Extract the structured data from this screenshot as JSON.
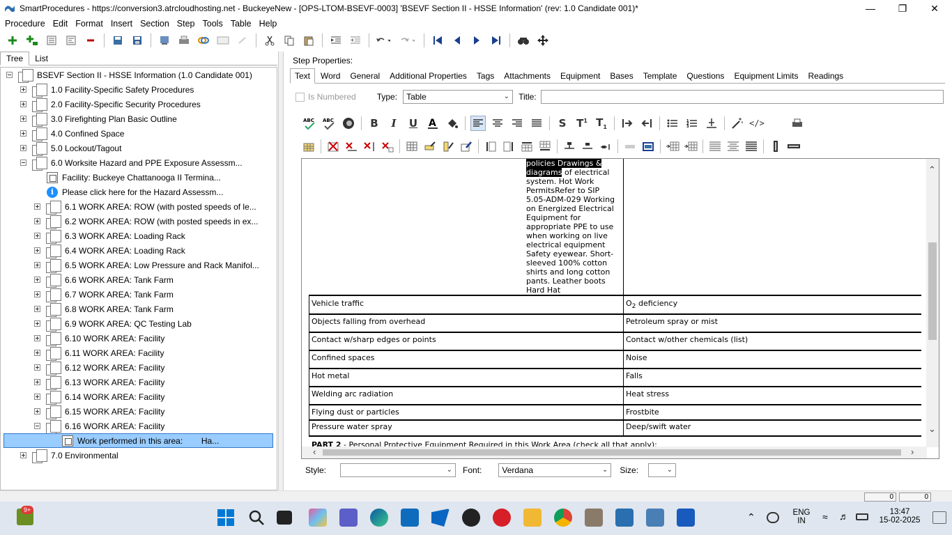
{
  "window": {
    "title": "SmartProcedures - https://conversion3.atrcloudhosting.net - BuckeyeNew - [OPS-LTOM-BSEVF-0003] 'BSEVF Section II - HSSE Information' (rev: 1.0 Candidate 001)*",
    "minimize": "—",
    "maximize": "❐",
    "close": "✕"
  },
  "menu": [
    "Procedure",
    "Edit",
    "Format",
    "Insert",
    "Section",
    "Step",
    "Tools",
    "Table",
    "Help"
  ],
  "left_tabs": [
    "Tree",
    "List"
  ],
  "tree": {
    "root": "BSEVF Section II - HSSE Information (1.0 Candidate 001)",
    "items": [
      {
        "label": "1.0 Facility-Specific Safety Procedures"
      },
      {
        "label": "2.0 Facility-Specific Security Procedures"
      },
      {
        "label": "3.0 Firefighting Plan Basic Outline"
      },
      {
        "label": "4.0 Confined Space"
      },
      {
        "label": "5.0 Lockout/Tagout"
      },
      {
        "label": "6.0 Worksite Hazard and PPE Exposure Assessm..."
      },
      {
        "label": "Facility: Buckeye Chattanooga II Termina..."
      },
      {
        "label": "Please click here for the Hazard Assessm..."
      },
      {
        "label": "6.1 WORK AREA: ROW (with posted speeds of le..."
      },
      {
        "label": "6.2 WORK AREA: ROW (with posted speeds in ex..."
      },
      {
        "label": "6.3 WORK AREA: Loading Rack"
      },
      {
        "label": "6.4 WORK AREA: Loading Rack"
      },
      {
        "label": "6.5 WORK AREA: Low Pressure and Rack Manifol..."
      },
      {
        "label": "6.6 WORK AREA: Tank Farm"
      },
      {
        "label": "6.7 WORK AREA: Tank Farm"
      },
      {
        "label": "6.8 WORK AREA: Tank Farm"
      },
      {
        "label": "6.9 WORK AREA: QC Testing Lab"
      },
      {
        "label": "6.10 WORK AREA: Facility"
      },
      {
        "label": "6.11 WORK AREA: Facility"
      },
      {
        "label": "6.12 WORK AREA: Facility"
      },
      {
        "label": "6.13 WORK AREA: Facility"
      },
      {
        "label": "6.14 WORK AREA: Facility"
      },
      {
        "label": "6.15 WORK AREA: Facility"
      },
      {
        "label": "6.16 WORK AREA: Facility"
      },
      {
        "label": "Work performed in this area:        Ha..."
      },
      {
        "label": "7.0 Environmental"
      }
    ]
  },
  "step_properties": {
    "heading": "Step Properties:",
    "tabs": [
      "Text",
      "Word",
      "General",
      "Additional Properties",
      "Tags",
      "Attachments",
      "Equipment",
      "Bases",
      "Template",
      "Questions",
      "Equipment Limits",
      "Readings"
    ],
    "is_numbered_label": "Is Numbered",
    "type_label": "Type:",
    "type_value": "Table",
    "title_label": "Title:",
    "title_value": ""
  },
  "editor": {
    "top_cell_highlight_1": "policies Drawings &",
    "top_cell_highlight_2": "diagrams",
    "top_cell_rest_1": " of electrical",
    "top_cell_lines": [
      "system. Hot Work",
      "PermitsRefer to SIP",
      "5.05-ADM-029 Working",
      "on Energized Electrical",
      "Equipment for",
      "appropriate PPE to use",
      "when working on live",
      "electrical equipment",
      "Safety eyewear. Short-",
      "sleeved 100% cotton",
      "shirts and long cotton",
      "pants. Leather boots",
      "Hard Hat"
    ],
    "rows": [
      {
        "left": "Vehicle traffic",
        "right_prefix": "O",
        "right_sub": "2",
        "right": " deficiency"
      },
      {
        "left": "Objects falling from overhead",
        "right": "Petroleum spray or mist"
      },
      {
        "left": "Contact w/sharp edges or points",
        "right": "Contact w/other chemicals (list)"
      },
      {
        "left": "Confined spaces",
        "right": "Noise"
      },
      {
        "left": "Hot metal",
        "right": "Falls"
      },
      {
        "left": "Welding arc radiation",
        "right": "Heat stress"
      },
      {
        "left": "Flying dust or particles",
        "right": "Frostbite"
      },
      {
        "left": "Pressure water spray",
        "right": "Deep/swift water"
      }
    ],
    "part2_bold": "PART 2",
    "part2_rest": " - Personal Protective Equipment Required in this Work Area (check all that apply):"
  },
  "style_row": {
    "style_label": "Style:",
    "style_value": "",
    "font_label": "Font:",
    "font_value": "Verdana",
    "size_label": "Size:",
    "size_value": ""
  },
  "status": [
    "0",
    "0"
  ],
  "taskbar": {
    "badge": "9+",
    "lang_1": "ENG",
    "lang_2": "IN",
    "time": "13:47",
    "date": "15-02-2025"
  }
}
